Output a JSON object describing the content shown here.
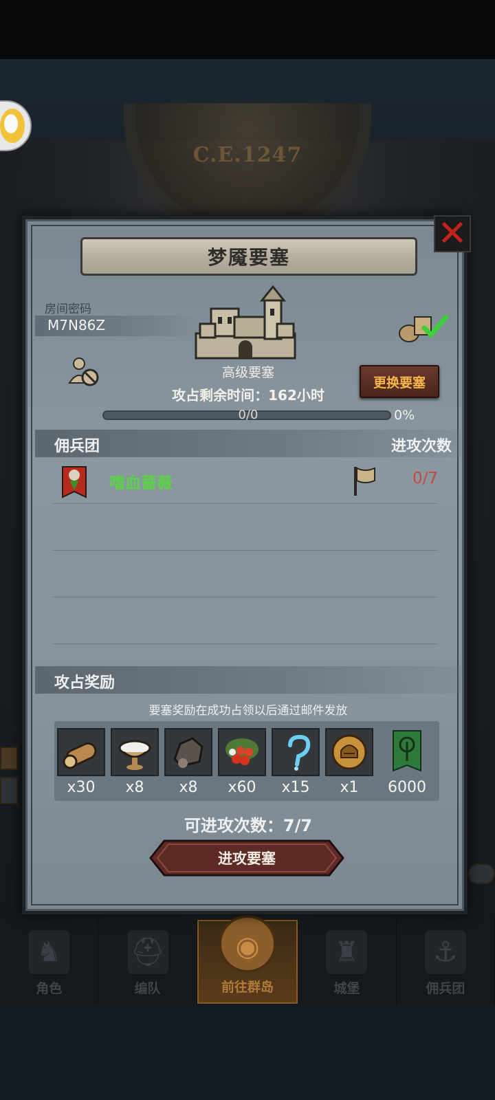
{
  "background": {
    "year_label": "C.E.1247"
  },
  "modal": {
    "title": "梦魇要塞",
    "close_icon": "close-icon",
    "room": {
      "label": "房间密码",
      "code": "M7N86Z"
    },
    "fortress": {
      "grade": "高级要塞"
    },
    "change_fortress_label": "更换要塞",
    "remaining_time": "攻占剩余时间：162小时",
    "progress": {
      "count_text": "0/0",
      "percent_text": "0%",
      "fraction": 0
    },
    "mercenary_section": {
      "title": "佣兵团",
      "attacks_header": "进攻次数",
      "rows": [
        {
          "name": "嗜血蔷薇",
          "attacks": "0/7"
        }
      ]
    },
    "reward_section": {
      "title": "攻占奖励",
      "note": "要塞奖励在成功占领以后通过邮件发放",
      "items": [
        {
          "icon": "log-icon",
          "qty": "x30"
        },
        {
          "icon": "salt-bowl-icon",
          "qty": "x8"
        },
        {
          "icon": "ore-icon",
          "qty": "x8"
        },
        {
          "icon": "berries-icon",
          "qty": "x60"
        },
        {
          "icon": "blue-hook-icon",
          "qty": "x15"
        },
        {
          "icon": "helmet-coin-icon",
          "qty": "x1"
        },
        {
          "icon": "tree-banner-icon",
          "qty": "6000"
        }
      ]
    },
    "attacks_available": "可进攻次数：7/7",
    "attack_button_label": "进攻要塞"
  },
  "bottom_nav": [
    {
      "label": "角色",
      "icon": "knight-icon",
      "active": false
    },
    {
      "label": "编队",
      "icon": "helmet-icon",
      "active": false
    },
    {
      "label": "前往群岛",
      "icon": "island-icon",
      "active": true
    },
    {
      "label": "城堡",
      "icon": "castle-icon",
      "active": false
    },
    {
      "label": "佣兵团",
      "icon": "ship-icon",
      "active": false
    }
  ],
  "colors": {
    "merc_name": "#5cd14a",
    "attacks_count": "#c44a3c",
    "change_button_text": "#f6b54a",
    "close_x": "#c4231b"
  }
}
